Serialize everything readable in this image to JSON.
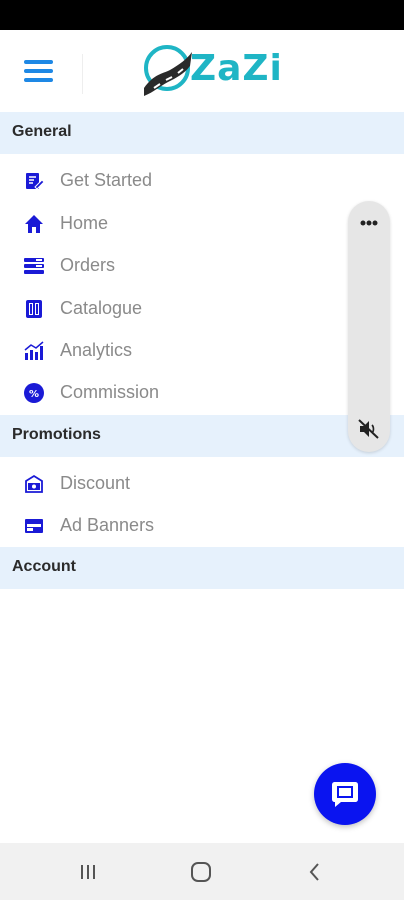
{
  "app": {
    "logo_text": "ZaZi"
  },
  "icons": {
    "menu": "hamburger-menu-icon",
    "more": "more-horizontal-icon",
    "mute": "volume-mute-icon",
    "chat": "chat-bubble-icon",
    "recents": "recents-icon",
    "home": "home-circle-icon",
    "back": "back-arrow-icon"
  },
  "colors": {
    "accent": "#1e88e5",
    "brand": "#1fb5c5",
    "icon_blue": "#1a1ad6",
    "section_bg": "#e6f1fc",
    "fab": "#0a14f0"
  },
  "sections": {
    "general": {
      "title": "General",
      "items": [
        {
          "label": "Get Started",
          "icon": "edit-document-icon"
        },
        {
          "label": "Home",
          "icon": "house-icon"
        },
        {
          "label": "Orders",
          "icon": "list-icon"
        },
        {
          "label": "Catalogue",
          "icon": "book-icon"
        },
        {
          "label": "Analytics",
          "icon": "bar-chart-icon"
        },
        {
          "label": "Commission",
          "icon": "percent-badge-icon"
        }
      ]
    },
    "promotions": {
      "title": "Promotions",
      "items": [
        {
          "label": "Discount",
          "icon": "discount-tag-icon"
        },
        {
          "label": "Ad Banners",
          "icon": "banner-icon"
        }
      ]
    },
    "account": {
      "title": "Account"
    }
  }
}
